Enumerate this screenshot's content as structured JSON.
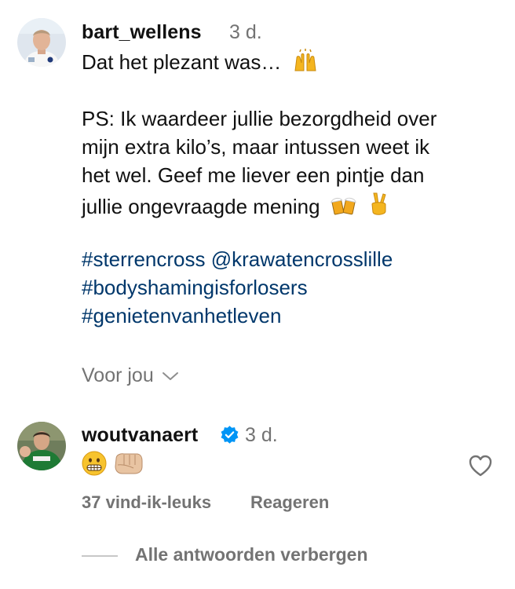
{
  "comment1": {
    "username": "bart_wellens",
    "time": "3 d.",
    "line1": "Dat het plezant was…",
    "line1_emoji": "raising-hands-emoji",
    "ps_lines": [
      "PS: Ik waardeer jullie bezorgdheid over",
      "mijn extra kilo’s, maar intussen weet ik",
      "het wel. Geef me liever een pintje dan",
      "jullie ongevraagde mening"
    ],
    "ps_emojis": [
      "beer-mugs-emoji",
      "victory-hand-emoji"
    ],
    "hashtags": [
      "#sterrencross @krawatencrosslille",
      "#bodyshamingisforlosers",
      "#genietenvanhetleven"
    ],
    "more_label": "Voor jou"
  },
  "comment2": {
    "username": "woutvanaert",
    "verified": true,
    "time": "3 d.",
    "emojis": [
      "grimacing-face-emoji",
      "oncoming-fist-emoji"
    ],
    "likes": "37 vind-ik-leuks",
    "reply_label": "Reageren",
    "hide_replies_label": "Alle antwoorden verbergen"
  },
  "colors": {
    "text": "#111111",
    "muted": "#737373",
    "hashtag": "#00376b",
    "verified": "#0095f6"
  }
}
